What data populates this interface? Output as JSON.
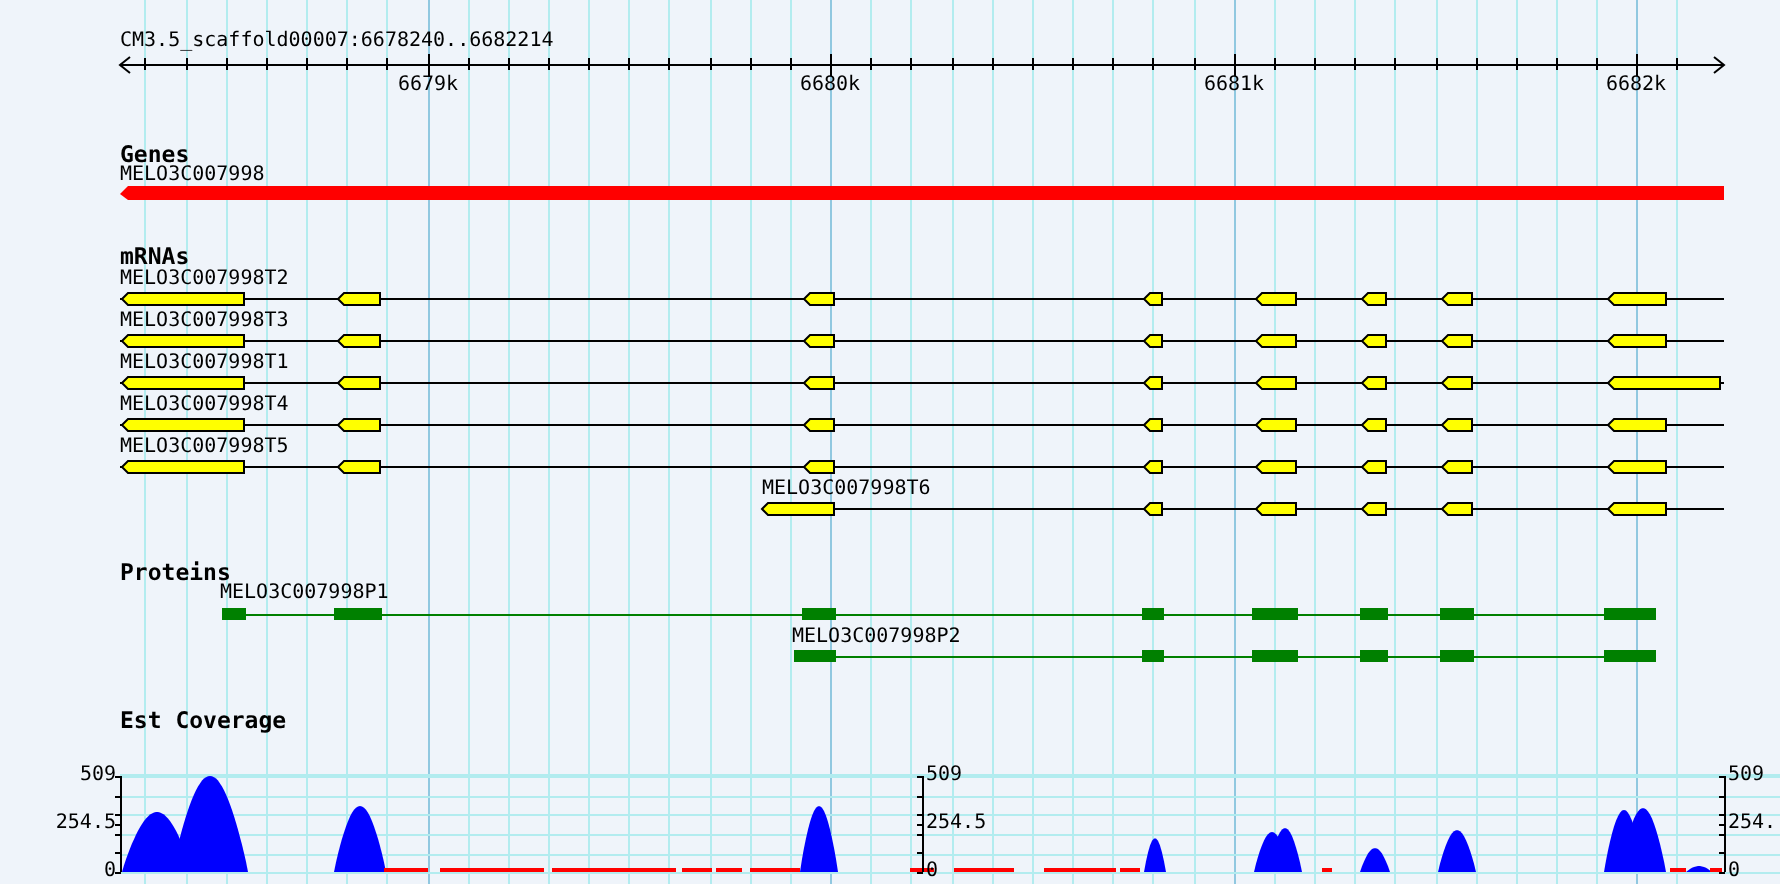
{
  "ruler": {
    "title": "CM3.5_scaffold00007:6678240..6682214",
    "ticks": [
      "6679k",
      "6680k",
      "6681k",
      "6682k"
    ]
  },
  "genes": {
    "heading": "Genes",
    "items": [
      {
        "name": "MELO3C007998"
      }
    ]
  },
  "mrnas": {
    "heading": "mRNAs",
    "items": [
      {
        "name": "MELO3C007998T2"
      },
      {
        "name": "MELO3C007998T3"
      },
      {
        "name": "MELO3C007998T1"
      },
      {
        "name": "MELO3C007998T4"
      },
      {
        "name": "MELO3C007998T5"
      },
      {
        "name": "MELO3C007998T6"
      }
    ]
  },
  "proteins": {
    "heading": "Proteins",
    "items": [
      {
        "name": "MELO3C007998P1"
      },
      {
        "name": "MELO3C007998P2"
      }
    ]
  },
  "coverage": {
    "heading": "Est Coverage",
    "axes": [
      {
        "labels": [
          "509",
          "254.5",
          "0"
        ]
      },
      {
        "labels": [
          "509",
          "254.5",
          "0"
        ]
      },
      {
        "labels": [
          "509",
          "254.",
          "0"
        ]
      }
    ]
  }
}
